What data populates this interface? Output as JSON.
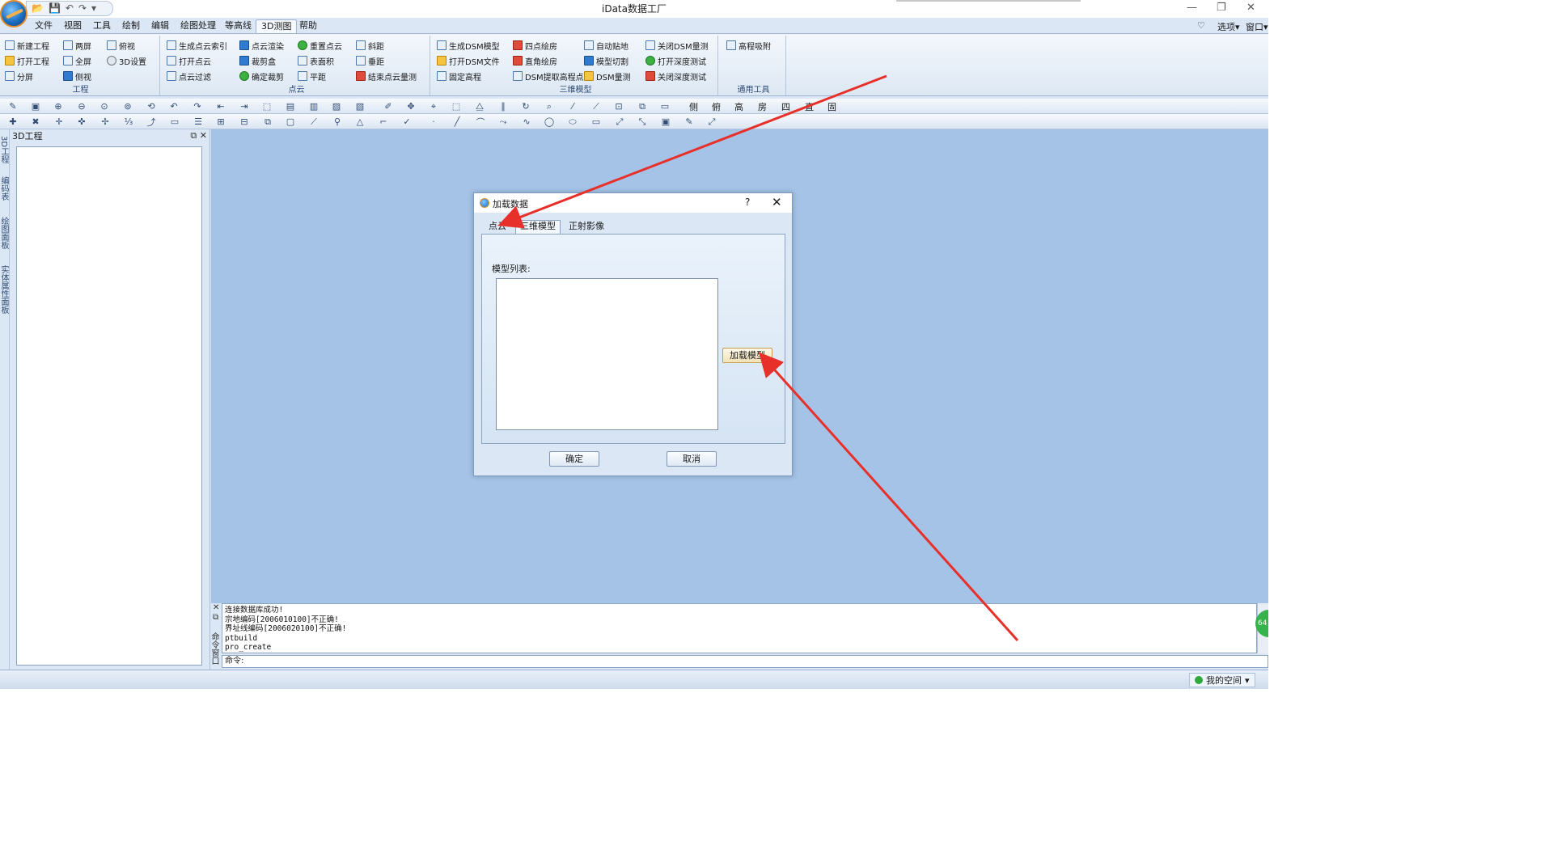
{
  "app": {
    "title": "iData数据工厂",
    "window_controls": {
      "minimize": "—",
      "restore": "❐",
      "close": "✕"
    }
  },
  "quick_access": {
    "open": "📂",
    "save": "💾",
    "undo": "↶",
    "redo": "↷",
    "more": "▾"
  },
  "menu": {
    "tabs": [
      "文件",
      "视图",
      "工具",
      "绘制",
      "编辑",
      "绘图处理",
      "等高线",
      "3D测图",
      "帮助"
    ],
    "active_tab": "3D测图",
    "options": "选项",
    "window": "窗口"
  },
  "ribbon": {
    "groups": [
      {
        "label": "工程",
        "items": [
          "新建工程",
          "两屏",
          "俯视",
          "打开工程",
          "全屏",
          "3D设置",
          "分屏",
          "侧视"
        ]
      },
      {
        "label": "点云",
        "items": [
          "生成点云索引",
          "点云渲染",
          "重置点云",
          "斜距",
          "打开点云",
          "裁剪盒",
          "表面积",
          "垂距",
          "点云过滤",
          "确定裁剪",
          "平距",
          "结束点云量测"
        ]
      },
      {
        "label": "三维模型",
        "items": [
          "生成DSM模型",
          "四点绘房",
          "自动贴地",
          "关闭DSM量测",
          "打开DSM文件",
          "直角绘房",
          "模型切割",
          "打开深度测试",
          "固定高程",
          "DSM提取高程点",
          "DSM量测",
          "关闭深度测试"
        ]
      },
      {
        "label": "通用工具",
        "items": [
          "高程吸附"
        ]
      }
    ]
  },
  "toolbar_chars": [
    "侧",
    "俯",
    "高",
    "房",
    "四",
    "直",
    "固"
  ],
  "side_tabs": [
    "3D工程",
    "编码表",
    "绘图面板",
    "实体属性面板"
  ],
  "left_panel": {
    "title": "3D工程"
  },
  "dialog": {
    "title": "加载数据",
    "help": "?",
    "close": "✕",
    "tabs": [
      "点云",
      "三维模型",
      "正射影像"
    ],
    "active_tab": "三维模型",
    "model_list_label": "模型列表:",
    "load_model_button": "加载模型",
    "ok_button": "确定",
    "cancel_button": "取消"
  },
  "command": {
    "output_lines": [
      "连接数据库成功!",
      "宗地编码[2006010100]不正确!",
      "界址线编码[2006020100]不正确!",
      "ptbuild",
      "pro_create"
    ],
    "side_label": "命令窗口",
    "prompt": "命令:"
  },
  "status": {
    "space_label": "我的空间"
  },
  "colors": {
    "annotation_arrow": "#e8302a",
    "workspace": "#a4c3e7"
  }
}
